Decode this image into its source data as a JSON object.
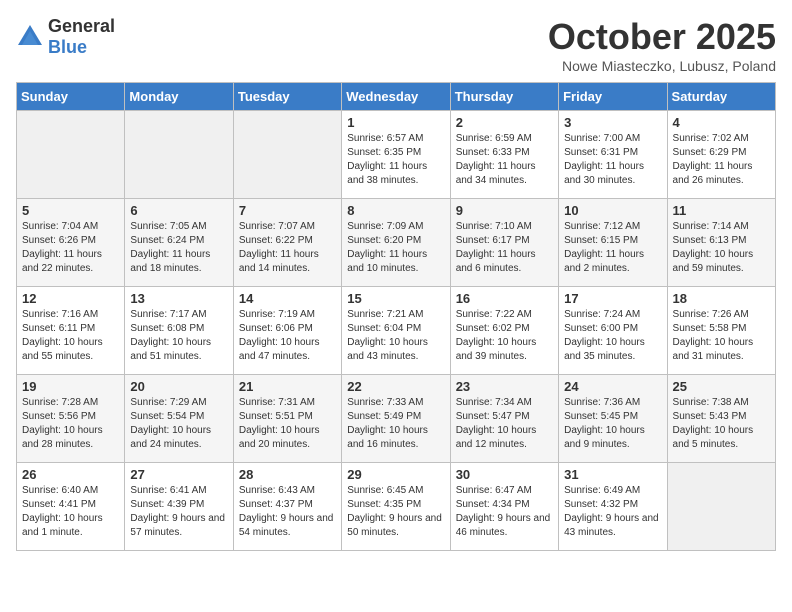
{
  "logo": {
    "general": "General",
    "blue": "Blue"
  },
  "title": "October 2025",
  "subtitle": "Nowe Miasteczko, Lubusz, Poland",
  "days_of_week": [
    "Sunday",
    "Monday",
    "Tuesday",
    "Wednesday",
    "Thursday",
    "Friday",
    "Saturday"
  ],
  "weeks": [
    [
      {
        "day": "",
        "info": ""
      },
      {
        "day": "",
        "info": ""
      },
      {
        "day": "",
        "info": ""
      },
      {
        "day": "1",
        "info": "Sunrise: 6:57 AM\nSunset: 6:35 PM\nDaylight: 11 hours\nand 38 minutes."
      },
      {
        "day": "2",
        "info": "Sunrise: 6:59 AM\nSunset: 6:33 PM\nDaylight: 11 hours\nand 34 minutes."
      },
      {
        "day": "3",
        "info": "Sunrise: 7:00 AM\nSunset: 6:31 PM\nDaylight: 11 hours\nand 30 minutes."
      },
      {
        "day": "4",
        "info": "Sunrise: 7:02 AM\nSunset: 6:29 PM\nDaylight: 11 hours\nand 26 minutes."
      }
    ],
    [
      {
        "day": "5",
        "info": "Sunrise: 7:04 AM\nSunset: 6:26 PM\nDaylight: 11 hours\nand 22 minutes."
      },
      {
        "day": "6",
        "info": "Sunrise: 7:05 AM\nSunset: 6:24 PM\nDaylight: 11 hours\nand 18 minutes."
      },
      {
        "day": "7",
        "info": "Sunrise: 7:07 AM\nSunset: 6:22 PM\nDaylight: 11 hours\nand 14 minutes."
      },
      {
        "day": "8",
        "info": "Sunrise: 7:09 AM\nSunset: 6:20 PM\nDaylight: 11 hours\nand 10 minutes."
      },
      {
        "day": "9",
        "info": "Sunrise: 7:10 AM\nSunset: 6:17 PM\nDaylight: 11 hours\nand 6 minutes."
      },
      {
        "day": "10",
        "info": "Sunrise: 7:12 AM\nSunset: 6:15 PM\nDaylight: 11 hours\nand 2 minutes."
      },
      {
        "day": "11",
        "info": "Sunrise: 7:14 AM\nSunset: 6:13 PM\nDaylight: 10 hours\nand 59 minutes."
      }
    ],
    [
      {
        "day": "12",
        "info": "Sunrise: 7:16 AM\nSunset: 6:11 PM\nDaylight: 10 hours\nand 55 minutes."
      },
      {
        "day": "13",
        "info": "Sunrise: 7:17 AM\nSunset: 6:08 PM\nDaylight: 10 hours\nand 51 minutes."
      },
      {
        "day": "14",
        "info": "Sunrise: 7:19 AM\nSunset: 6:06 PM\nDaylight: 10 hours\nand 47 minutes."
      },
      {
        "day": "15",
        "info": "Sunrise: 7:21 AM\nSunset: 6:04 PM\nDaylight: 10 hours\nand 43 minutes."
      },
      {
        "day": "16",
        "info": "Sunrise: 7:22 AM\nSunset: 6:02 PM\nDaylight: 10 hours\nand 39 minutes."
      },
      {
        "day": "17",
        "info": "Sunrise: 7:24 AM\nSunset: 6:00 PM\nDaylight: 10 hours\nand 35 minutes."
      },
      {
        "day": "18",
        "info": "Sunrise: 7:26 AM\nSunset: 5:58 PM\nDaylight: 10 hours\nand 31 minutes."
      }
    ],
    [
      {
        "day": "19",
        "info": "Sunrise: 7:28 AM\nSunset: 5:56 PM\nDaylight: 10 hours\nand 28 minutes."
      },
      {
        "day": "20",
        "info": "Sunrise: 7:29 AM\nSunset: 5:54 PM\nDaylight: 10 hours\nand 24 minutes."
      },
      {
        "day": "21",
        "info": "Sunrise: 7:31 AM\nSunset: 5:51 PM\nDaylight: 10 hours\nand 20 minutes."
      },
      {
        "day": "22",
        "info": "Sunrise: 7:33 AM\nSunset: 5:49 PM\nDaylight: 10 hours\nand 16 minutes."
      },
      {
        "day": "23",
        "info": "Sunrise: 7:34 AM\nSunset: 5:47 PM\nDaylight: 10 hours\nand 12 minutes."
      },
      {
        "day": "24",
        "info": "Sunrise: 7:36 AM\nSunset: 5:45 PM\nDaylight: 10 hours\nand 9 minutes."
      },
      {
        "day": "25",
        "info": "Sunrise: 7:38 AM\nSunset: 5:43 PM\nDaylight: 10 hours\nand 5 minutes."
      }
    ],
    [
      {
        "day": "26",
        "info": "Sunrise: 6:40 AM\nSunset: 4:41 PM\nDaylight: 10 hours\nand 1 minute."
      },
      {
        "day": "27",
        "info": "Sunrise: 6:41 AM\nSunset: 4:39 PM\nDaylight: 9 hours\nand 57 minutes."
      },
      {
        "day": "28",
        "info": "Sunrise: 6:43 AM\nSunset: 4:37 PM\nDaylight: 9 hours\nand 54 minutes."
      },
      {
        "day": "29",
        "info": "Sunrise: 6:45 AM\nSunset: 4:35 PM\nDaylight: 9 hours\nand 50 minutes."
      },
      {
        "day": "30",
        "info": "Sunrise: 6:47 AM\nSunset: 4:34 PM\nDaylight: 9 hours\nand 46 minutes."
      },
      {
        "day": "31",
        "info": "Sunrise: 6:49 AM\nSunset: 4:32 PM\nDaylight: 9 hours\nand 43 minutes."
      },
      {
        "day": "",
        "info": ""
      }
    ]
  ]
}
